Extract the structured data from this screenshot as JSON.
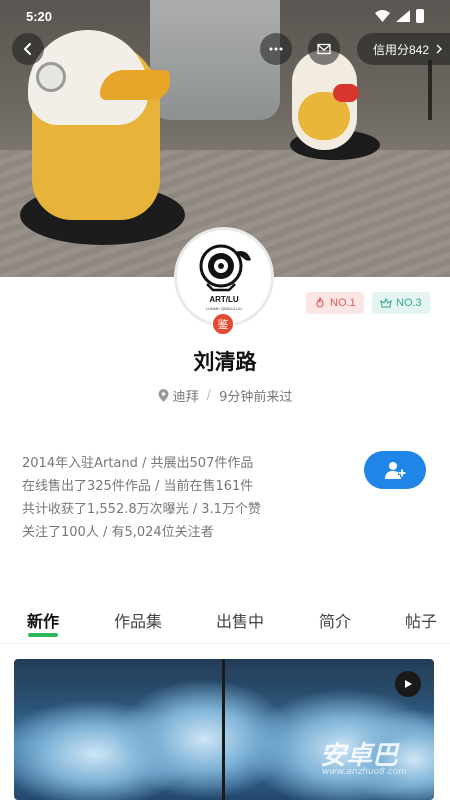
{
  "status_bar": {
    "time": "5:20"
  },
  "nav": {
    "credit_label": "信用分842"
  },
  "avatar": {
    "caption": "ART/LU",
    "sub_caption": "LUHAN / QINGLU LIU",
    "badge": "鉴"
  },
  "ranks": [
    {
      "label": "NO.1",
      "icon": "flame-icon",
      "color": "#e05a5a"
    },
    {
      "label": "NO.3",
      "icon": "crown-icon",
      "color": "#3aa793"
    }
  ],
  "profile": {
    "name": "刘清路",
    "location": "迪拜",
    "last_seen": "9分钟前来过"
  },
  "stats": [
    "2014年入驻Artand / 共展出507件作品",
    "在线售出了325件作品 / 当前在售161件",
    "共计收获了1,552.8万次曝光 / 3.1万个赞",
    "关注了100人 / 有5,024位关注者"
  ],
  "tabs": [
    {
      "label": "新作",
      "active": true
    },
    {
      "label": "作品集",
      "active": false
    },
    {
      "label": "出售中",
      "active": false
    },
    {
      "label": "简介",
      "active": false
    },
    {
      "label": "帖子",
      "active": false
    }
  ],
  "watermark": {
    "text": "安卓巴",
    "url": "www.anzhuo8.com"
  },
  "colors": {
    "accent": "#1f86e8",
    "tab_indicator": "#2db85a",
    "badge": "#e24a34"
  }
}
